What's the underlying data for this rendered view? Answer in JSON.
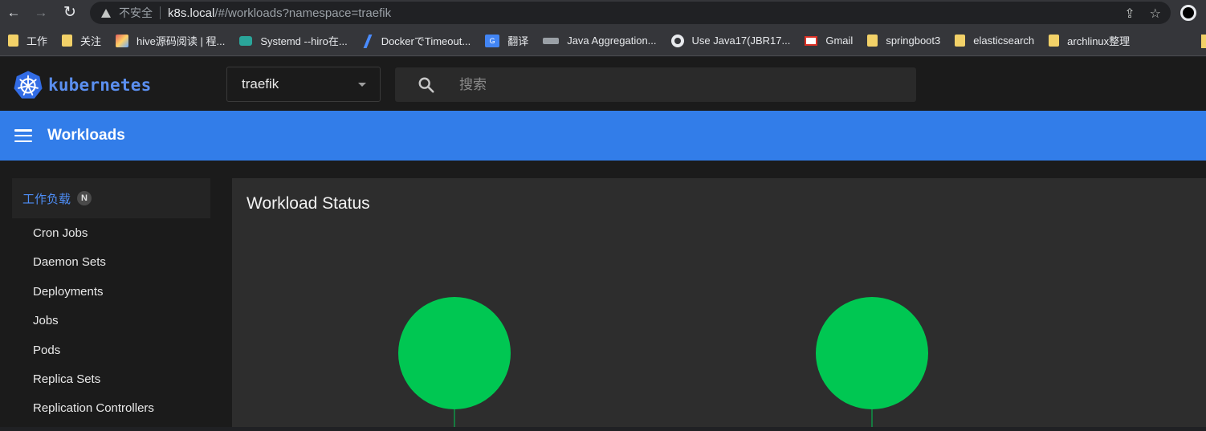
{
  "browser": {
    "nav": {
      "back": "←",
      "forward": "→",
      "reload": "↻"
    },
    "security_label": "不安全",
    "url_host": "k8s.local",
    "url_path": "/#/workloads?namespace=traefik",
    "actions": {
      "share": "⇪",
      "bookmark": "☆"
    }
  },
  "bookmarks": [
    {
      "label": "工作",
      "icon": "folder-icon"
    },
    {
      "label": "关注",
      "icon": "folder-icon"
    },
    {
      "label": "hive源码阅读 | 程...",
      "icon": "site-icon"
    },
    {
      "label": "Systemd --hiro在...",
      "icon": "site-icon"
    },
    {
      "label": "DockerでTimeout...",
      "icon": "site-icon"
    },
    {
      "label": "翻译",
      "icon": "translate-icon"
    },
    {
      "label": "Java Aggregation...",
      "icon": "java-icon"
    },
    {
      "label": "Use Java17(JBR17...",
      "icon": "github-icon"
    },
    {
      "label": "Gmail",
      "icon": "gmail-icon"
    },
    {
      "label": "springboot3",
      "icon": "folder-icon"
    },
    {
      "label": "elasticsearch",
      "icon": "folder-icon"
    },
    {
      "label": "archlinux整理",
      "icon": "folder-icon"
    }
  ],
  "app": {
    "logo_text": "kubernetes",
    "namespace": {
      "selected": "traefik"
    },
    "search": {
      "placeholder": "搜索"
    },
    "toolbar": {
      "title": "Workloads"
    },
    "sidebar": {
      "header": "工作负载",
      "badge": "N",
      "items": [
        {
          "label": "Cron Jobs"
        },
        {
          "label": "Daemon Sets"
        },
        {
          "label": "Deployments"
        },
        {
          "label": "Jobs"
        },
        {
          "label": "Pods"
        },
        {
          "label": "Replica Sets"
        },
        {
          "label": "Replication Controllers"
        }
      ]
    },
    "card": {
      "title": "Workload Status"
    }
  },
  "chart_data": {
    "type": "pie",
    "charts": [
      {
        "slices": [
          {
            "value": 100,
            "color": "#00c752"
          }
        ]
      },
      {
        "slices": [
          {
            "value": 100,
            "color": "#00c752"
          }
        ]
      }
    ]
  }
}
